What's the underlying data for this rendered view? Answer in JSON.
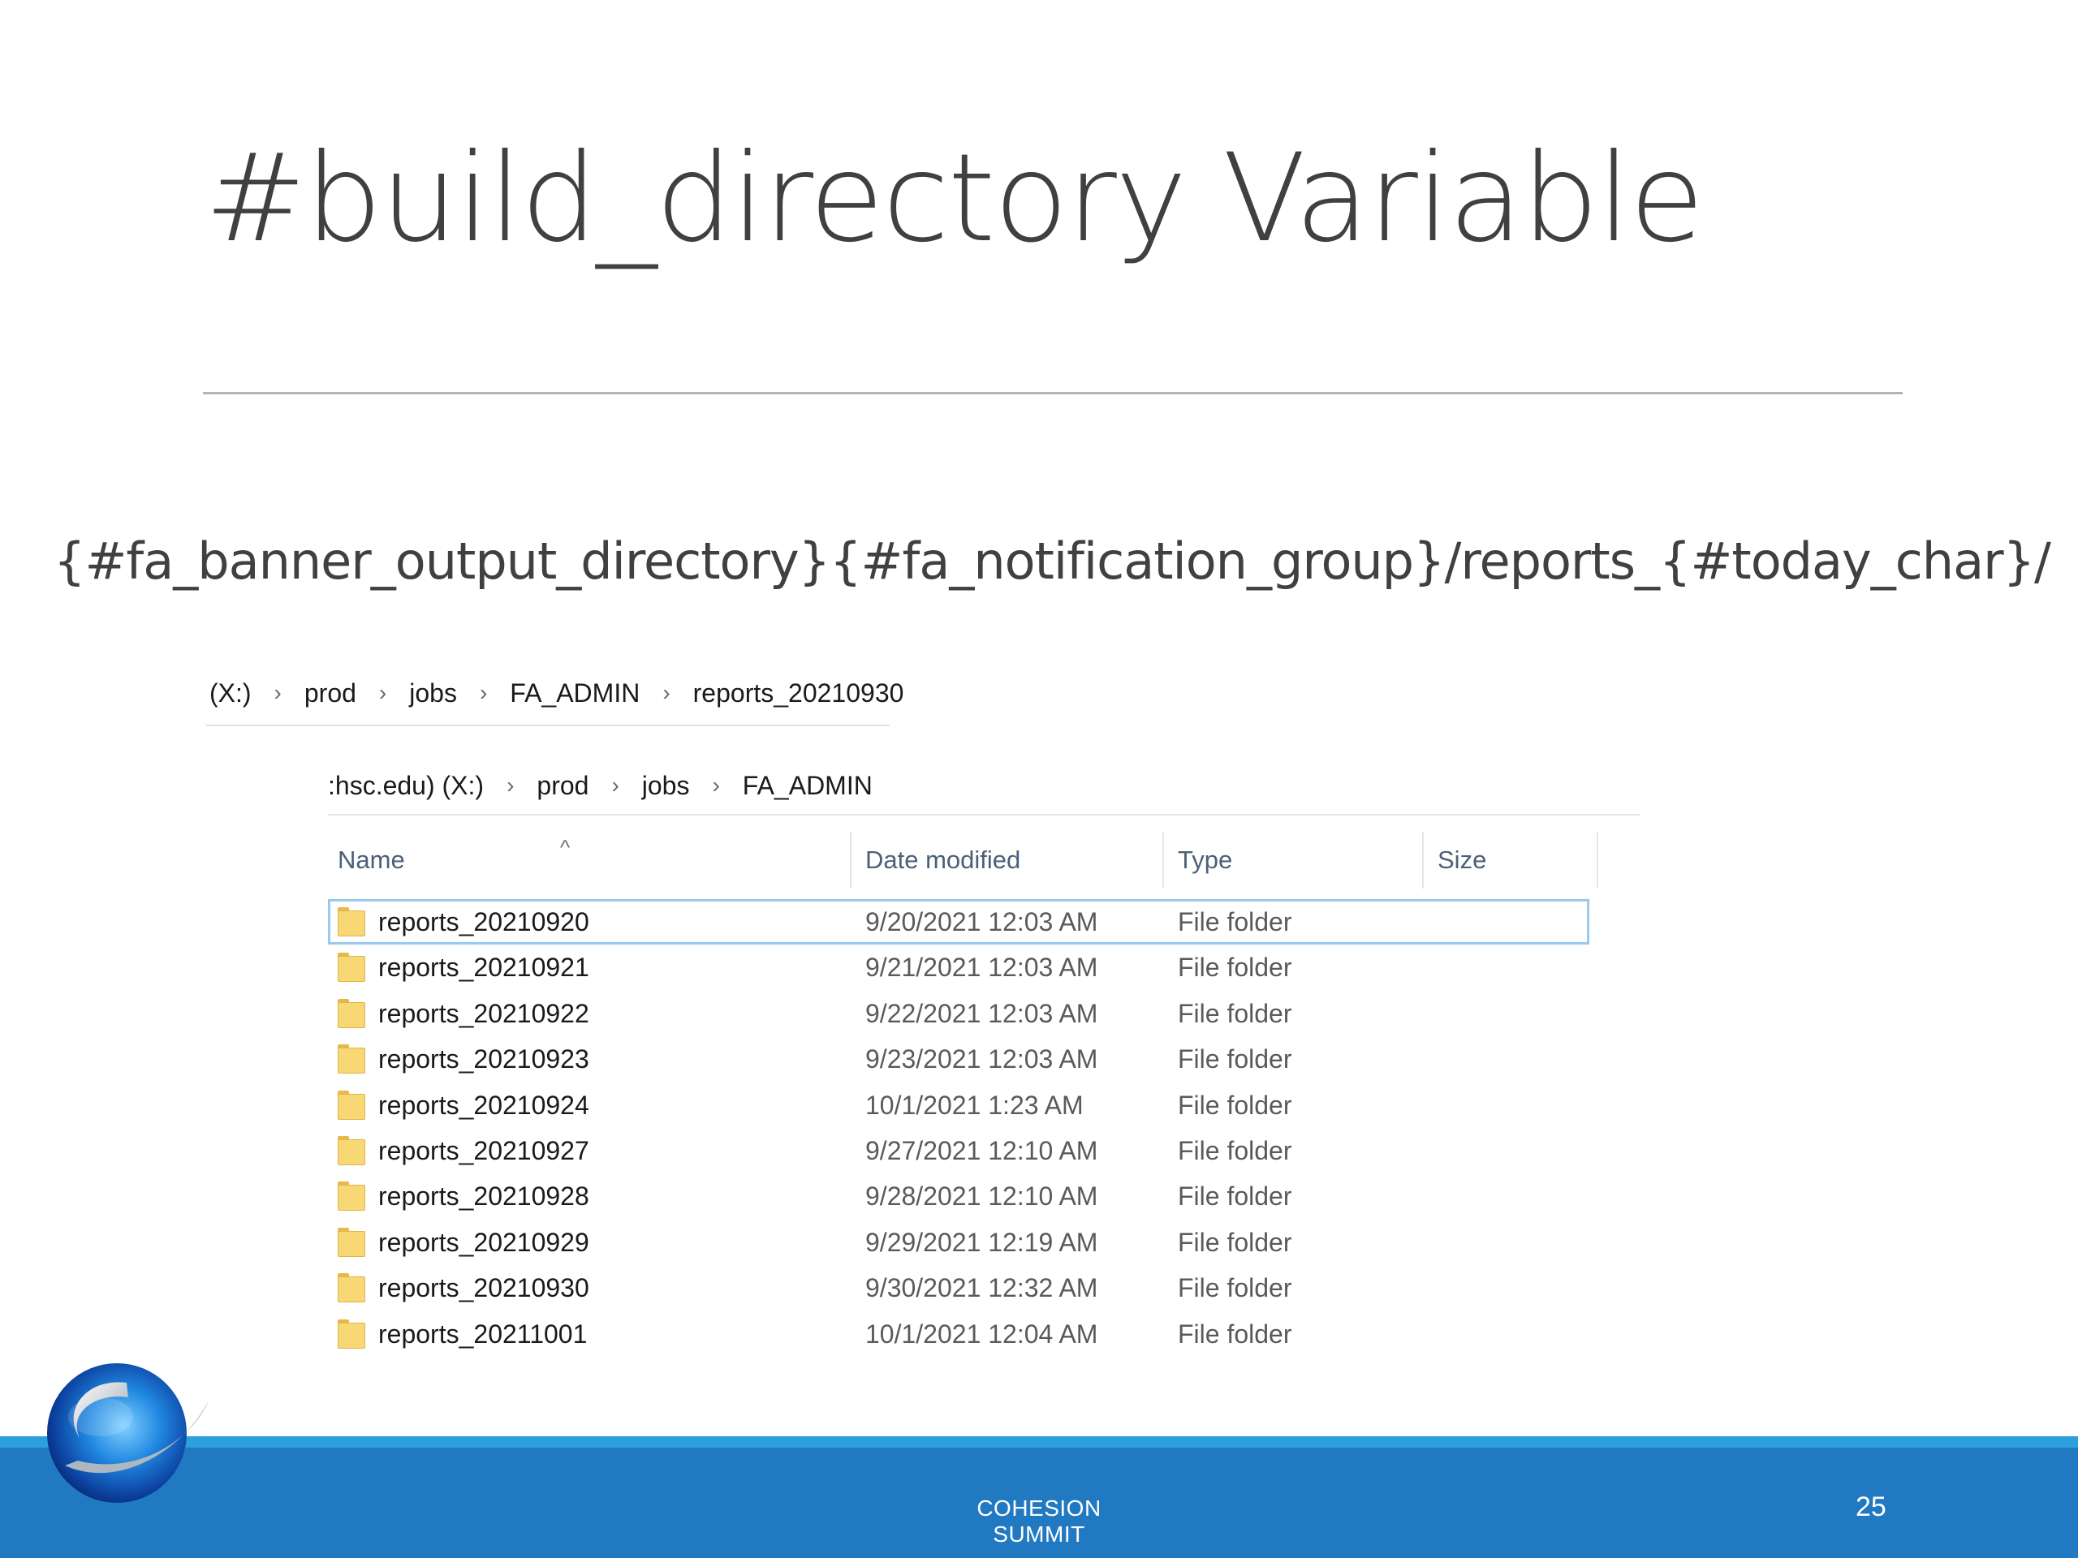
{
  "slide": {
    "title": "#build_directory Variable",
    "path_template": "{#fa_banner_output_directory}{#fa_notification_group}/reports_{#today_char}/"
  },
  "breadcrumb_top": [
    "(X:)",
    "prod",
    "jobs",
    "FA_ADMIN",
    "reports_20210930"
  ],
  "breadcrumb_bottom": [
    ":hsc.edu) (X:)",
    "prod",
    "jobs",
    "FA_ADMIN"
  ],
  "explorer": {
    "columns": {
      "name": "Name",
      "date": "Date modified",
      "type": "Type",
      "size": "Size"
    },
    "rows": [
      {
        "name": "reports_20210920",
        "date": "9/20/2021 12:03 AM",
        "type": "File folder"
      },
      {
        "name": "reports_20210921",
        "date": "9/21/2021 12:03 AM",
        "type": "File folder"
      },
      {
        "name": "reports_20210922",
        "date": "9/22/2021 12:03 AM",
        "type": "File folder"
      },
      {
        "name": "reports_20210923",
        "date": "9/23/2021 12:03 AM",
        "type": "File folder"
      },
      {
        "name": "reports_20210924",
        "date": "10/1/2021 1:23 AM",
        "type": "File folder"
      },
      {
        "name": "reports_20210927",
        "date": "9/27/2021 12:10 AM",
        "type": "File folder"
      },
      {
        "name": "reports_20210928",
        "date": "9/28/2021 12:10 AM",
        "type": "File folder"
      },
      {
        "name": "reports_20210929",
        "date": "9/29/2021 12:19 AM",
        "type": "File folder"
      },
      {
        "name": "reports_20210930",
        "date": "9/30/2021 12:32 AM",
        "type": "File folder"
      },
      {
        "name": "reports_20211001",
        "date": "10/1/2021 12:04 AM",
        "type": "File folder"
      }
    ],
    "selected_row": 0,
    "folder_icon": "folder-icon"
  },
  "footer": {
    "text": "COHESION SUMMIT",
    "page_number": "25",
    "accent_color": "#2179c1",
    "thin_band_color": "#2ba0dc"
  }
}
